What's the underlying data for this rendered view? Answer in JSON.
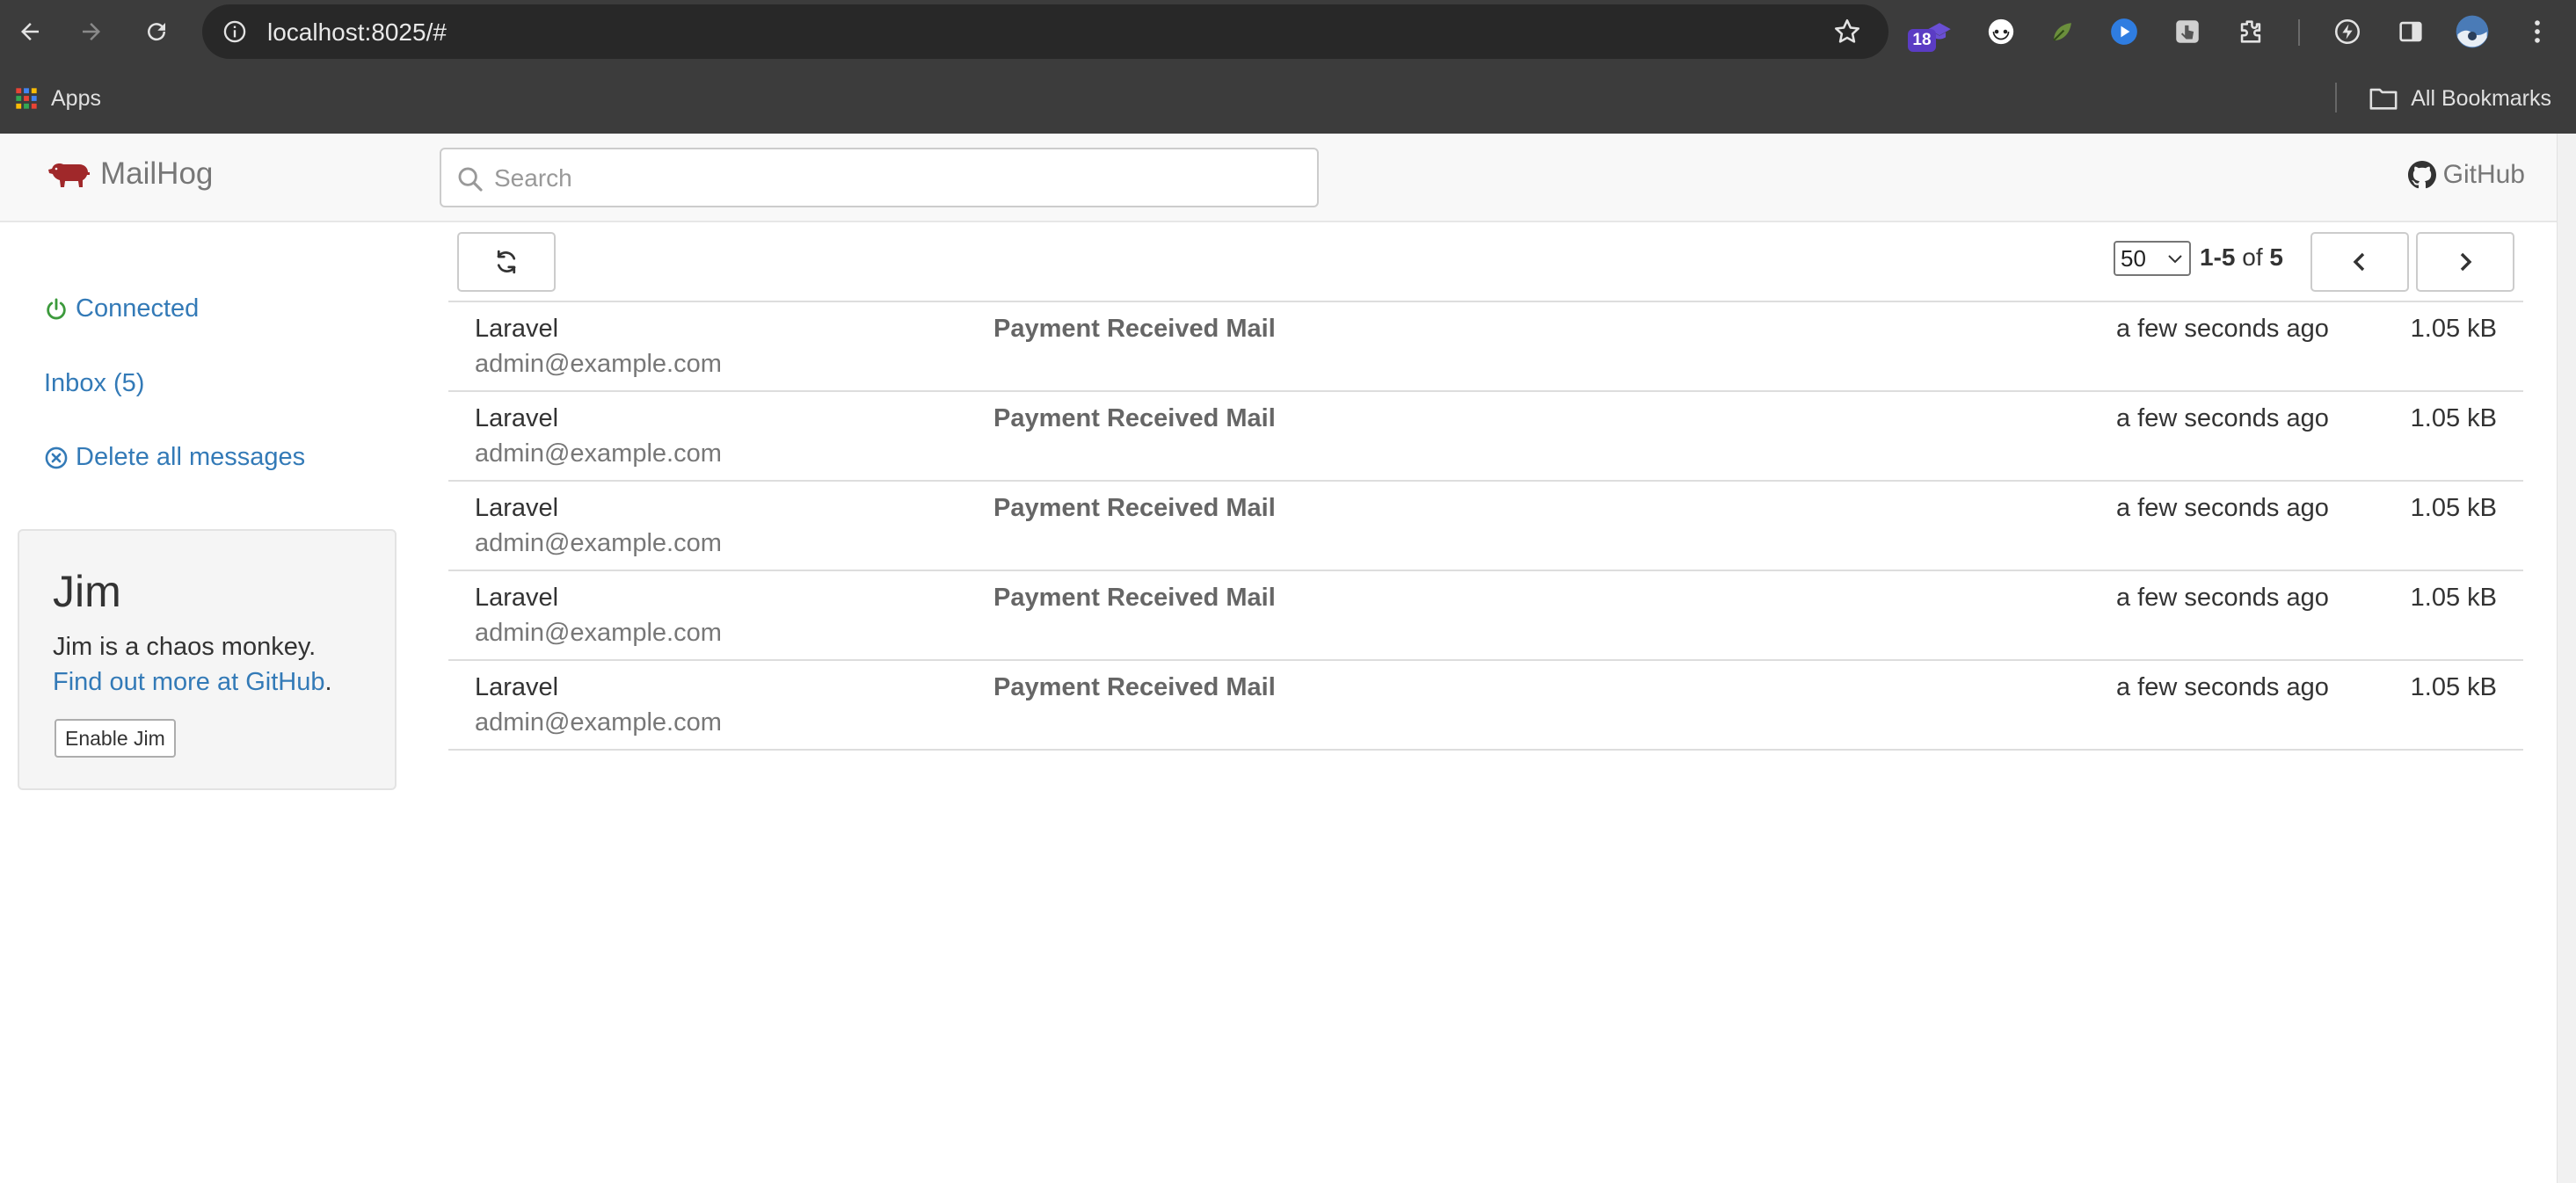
{
  "browser": {
    "url": "localhost:8025/#",
    "extension_badge": "18",
    "bookmarks": {
      "apps_label": "Apps",
      "all_label": "All Bookmarks"
    }
  },
  "app": {
    "brand": "MailHog",
    "search_placeholder": "Search",
    "github_label": "GitHub"
  },
  "sidebar": {
    "connected": "Connected",
    "inbox": "Inbox (5)",
    "delete_all": "Delete all messages"
  },
  "jim": {
    "title": "Jim",
    "description": "Jim is a chaos monkey.",
    "link_text": "Find out more at GitHub",
    "link_suffix": ".",
    "button": "Enable Jim"
  },
  "pagination": {
    "per_page": "50",
    "range": "1-5",
    "of_label": "of",
    "total": "5"
  },
  "messages": [
    {
      "from": "Laravel",
      "email": "admin@example.com",
      "subject": "Payment Received Mail",
      "time": "a few seconds ago",
      "size": "1.05 kB"
    },
    {
      "from": "Laravel",
      "email": "admin@example.com",
      "subject": "Payment Received Mail",
      "time": "a few seconds ago",
      "size": "1.05 kB"
    },
    {
      "from": "Laravel",
      "email": "admin@example.com",
      "subject": "Payment Received Mail",
      "time": "a few seconds ago",
      "size": "1.05 kB"
    },
    {
      "from": "Laravel",
      "email": "admin@example.com",
      "subject": "Payment Received Mail",
      "time": "a few seconds ago",
      "size": "1.05 kB"
    },
    {
      "from": "Laravel",
      "email": "admin@example.com",
      "subject": "Payment Received Mail",
      "time": "a few seconds ago",
      "size": "1.05 kB"
    }
  ],
  "colors": {
    "link": "#337ab7",
    "connected": "#3c9a3c",
    "brand_icon": "#a0282a",
    "chrome_bg": "#3c3c3c"
  }
}
